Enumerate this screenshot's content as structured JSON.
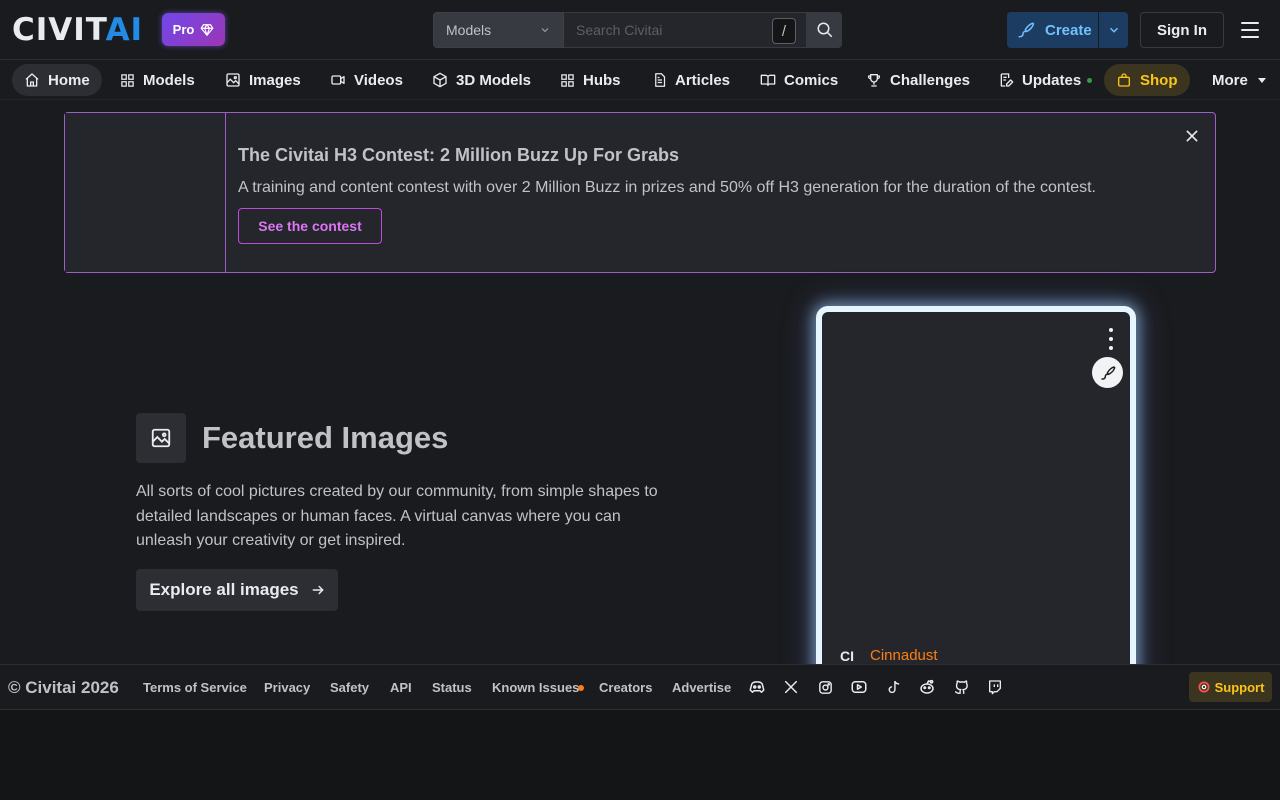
{
  "header": {
    "logo_left": "CIVIT",
    "logo_right": "AI",
    "pro_label": "Pro",
    "search_category": "Models",
    "search_placeholder": "Search Civitai",
    "search_shortcut": "/",
    "create_label": "Create",
    "signin_label": "Sign In"
  },
  "nav": {
    "items": [
      {
        "label": "Home",
        "icon": "home-icon"
      },
      {
        "label": "Models",
        "icon": "grid-icon"
      },
      {
        "label": "Images",
        "icon": "photo-icon"
      },
      {
        "label": "Videos",
        "icon": "video-icon"
      },
      {
        "label": "3D Models",
        "icon": "cube-icon"
      },
      {
        "label": "Hubs",
        "icon": "grid-icon"
      },
      {
        "label": "Articles",
        "icon": "file-icon"
      },
      {
        "label": "Comics",
        "icon": "book-icon"
      },
      {
        "label": "Challenges",
        "icon": "trophy-icon"
      },
      {
        "label": "Updates",
        "icon": "edit-icon"
      },
      {
        "label": "Shop",
        "icon": "shopping-bag-icon"
      },
      {
        "label": "More",
        "icon": "caret-down-icon"
      }
    ]
  },
  "banner": {
    "title": "The Civitai H3 Contest: 2 Million Buzz Up For Grabs",
    "description": "A training and content contest with over 2 Million Buzz in prizes and 50% off H3 generation for the duration of the contest.",
    "button_label": "See the contest"
  },
  "featured": {
    "title": "Featured Images",
    "description": "All sorts of cool pictures created by our community, from simple shapes to detailed landscapes or human faces. A virtual canvas where you can unleash your creativity or get inspired.",
    "button_label": "Explore all images"
  },
  "card": {
    "avatar_initials": "CI",
    "username": "Cinnadust"
  },
  "footer": {
    "copyright": "© Civitai 2026",
    "links": [
      "Terms of Service",
      "Privacy",
      "Safety",
      "API",
      "Status",
      "Known Issues",
      "Creators",
      "Advertise"
    ],
    "socials": [
      "discord-icon",
      "x-icon",
      "instagram-icon",
      "youtube-icon",
      "tiktok-icon",
      "reddit-icon",
      "github-icon",
      "twitch-icon"
    ],
    "support_label": "Support"
  },
  "colors": {
    "background": "#1a1b1e",
    "accent_blue": "#228be6",
    "banner_border": "#9c5fc9",
    "shop_yellow": "#fcc419",
    "username_orange": "#fd7e14"
  }
}
